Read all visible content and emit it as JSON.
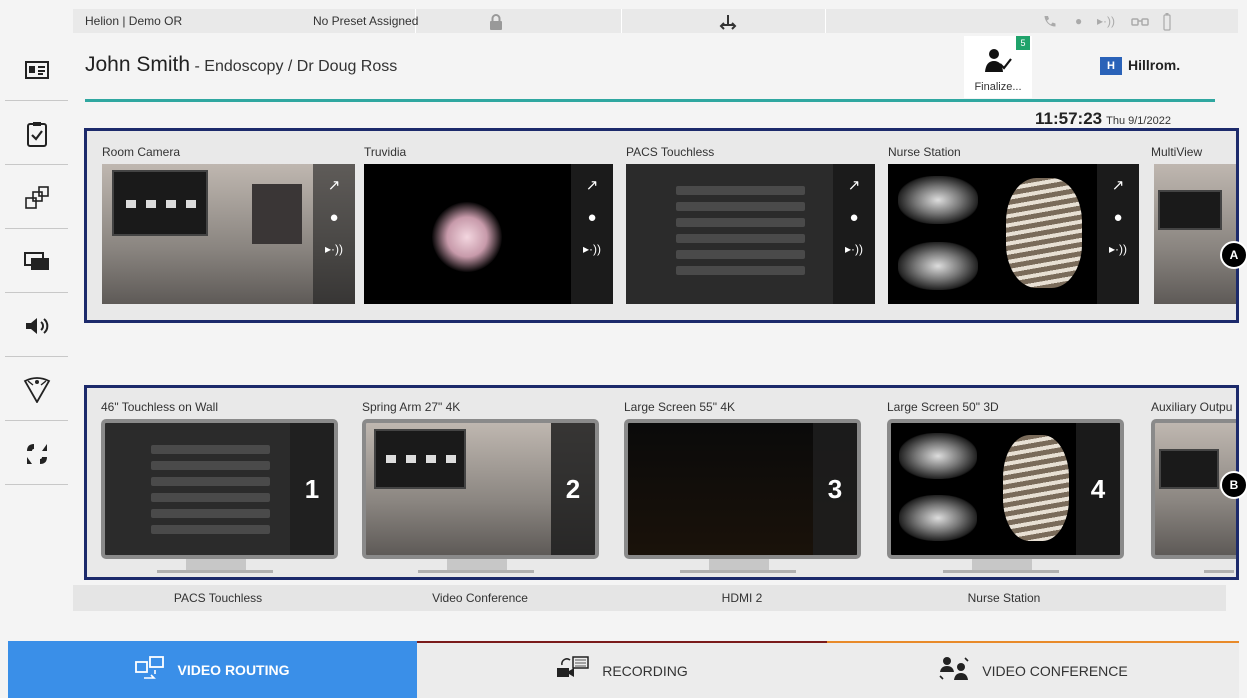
{
  "topbar": {
    "room": "Helion | Demo OR",
    "preset": "No Preset Assigned",
    "lock_icon": "lock-icon",
    "status_icons": [
      "phone-icon",
      "record-dot-icon",
      "stream-icon",
      "glasses-icon",
      "battery-icon"
    ]
  },
  "header": {
    "patient_name": "John Smith",
    "patient_detail": " - Endoscopy / Dr Doug Ross",
    "finalize_label": "Finalize...",
    "finalize_badge": "5",
    "brand_mark": "H",
    "brand_name": "Hillrom.",
    "time": "11:57:23",
    "date": "Thu 9/1/2022"
  },
  "sidebar": {
    "items": [
      "patient-card-icon",
      "checklist-icon",
      "layout-icon",
      "screen-icon",
      "audio-icon",
      "light-icon",
      "camera-control-icon"
    ]
  },
  "sources": {
    "badge": "A",
    "items": [
      {
        "label": "Room Camera"
      },
      {
        "label": "Truvidia"
      },
      {
        "label": "PACS Touchless"
      },
      {
        "label": "Nurse Station"
      },
      {
        "label": "MultiView"
      }
    ],
    "controls": {
      "expand": "↗",
      "record": "●",
      "stream": "▸·))"
    }
  },
  "destinations": {
    "badge": "B",
    "items": [
      {
        "label": "46\" Touchless on Wall",
        "number": "1",
        "assigned": "PACS Touchless"
      },
      {
        "label": "Spring Arm 27\" 4K",
        "number": "2",
        "assigned": "Video Conference"
      },
      {
        "label": "Large Screen 55\" 4K",
        "number": "3",
        "assigned": "HDMI 2"
      },
      {
        "label": "Large Screen 50\" 3D",
        "number": "4",
        "assigned": "Nurse Station"
      },
      {
        "label": "Auxiliary Outpu"
      }
    ]
  },
  "tabs": [
    {
      "label": "VIDEO ROUTING",
      "active": true,
      "color": "#3a8fe8"
    },
    {
      "label": "RECORDING",
      "active": false,
      "color": "#7a1b1b"
    },
    {
      "label": "VIDEO CONFERENCE",
      "active": false,
      "color": "#e88a2a"
    }
  ]
}
